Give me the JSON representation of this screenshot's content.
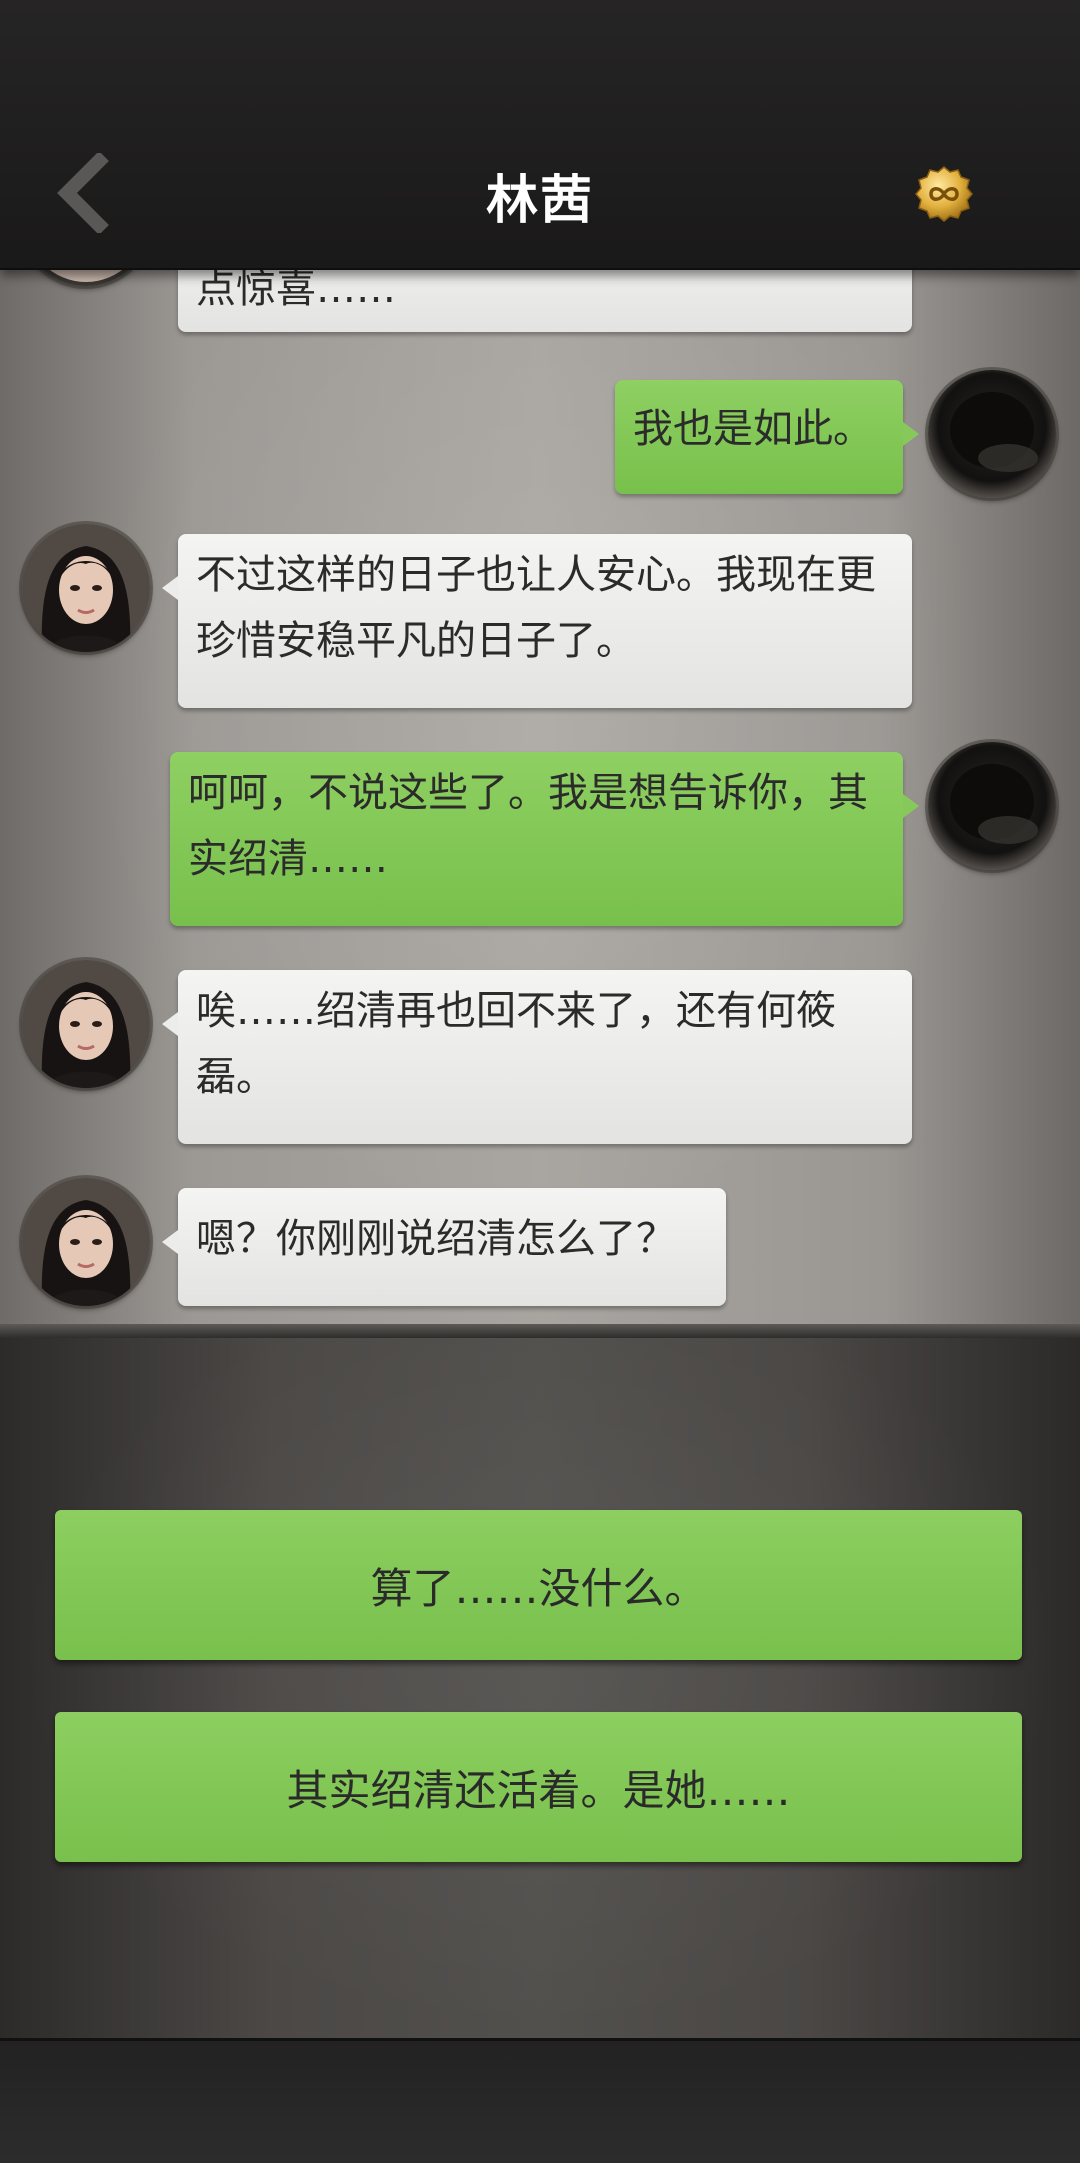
{
  "header": {
    "title": "林茜",
    "back_icon": "chevron-left-icon",
    "coin_icon": "infinity-coin-icon"
  },
  "messages": [
    {
      "side": "left",
      "text": "点惊喜……"
    },
    {
      "side": "right",
      "text": "我也是如此。"
    },
    {
      "side": "left",
      "text": "不过这样的日子也让人安心。我现在更珍惜安稳平凡的日子了。"
    },
    {
      "side": "right",
      "text": "呵呵，不说这些了。我是想告诉你，其实绍清……"
    },
    {
      "side": "left",
      "text": "唉……绍清再也回不来了，还有何筱磊。"
    },
    {
      "side": "left",
      "text": "嗯？你刚刚说绍清怎么了？"
    }
  ],
  "choices": [
    {
      "label": "算了……没什么。"
    },
    {
      "label": "其实绍清还活着。是她……"
    }
  ],
  "colors": {
    "player_bubble": "#84c858",
    "npc_bubble": "#eeeeec",
    "choice_button": "#84c858",
    "header_bg": "#222121"
  }
}
